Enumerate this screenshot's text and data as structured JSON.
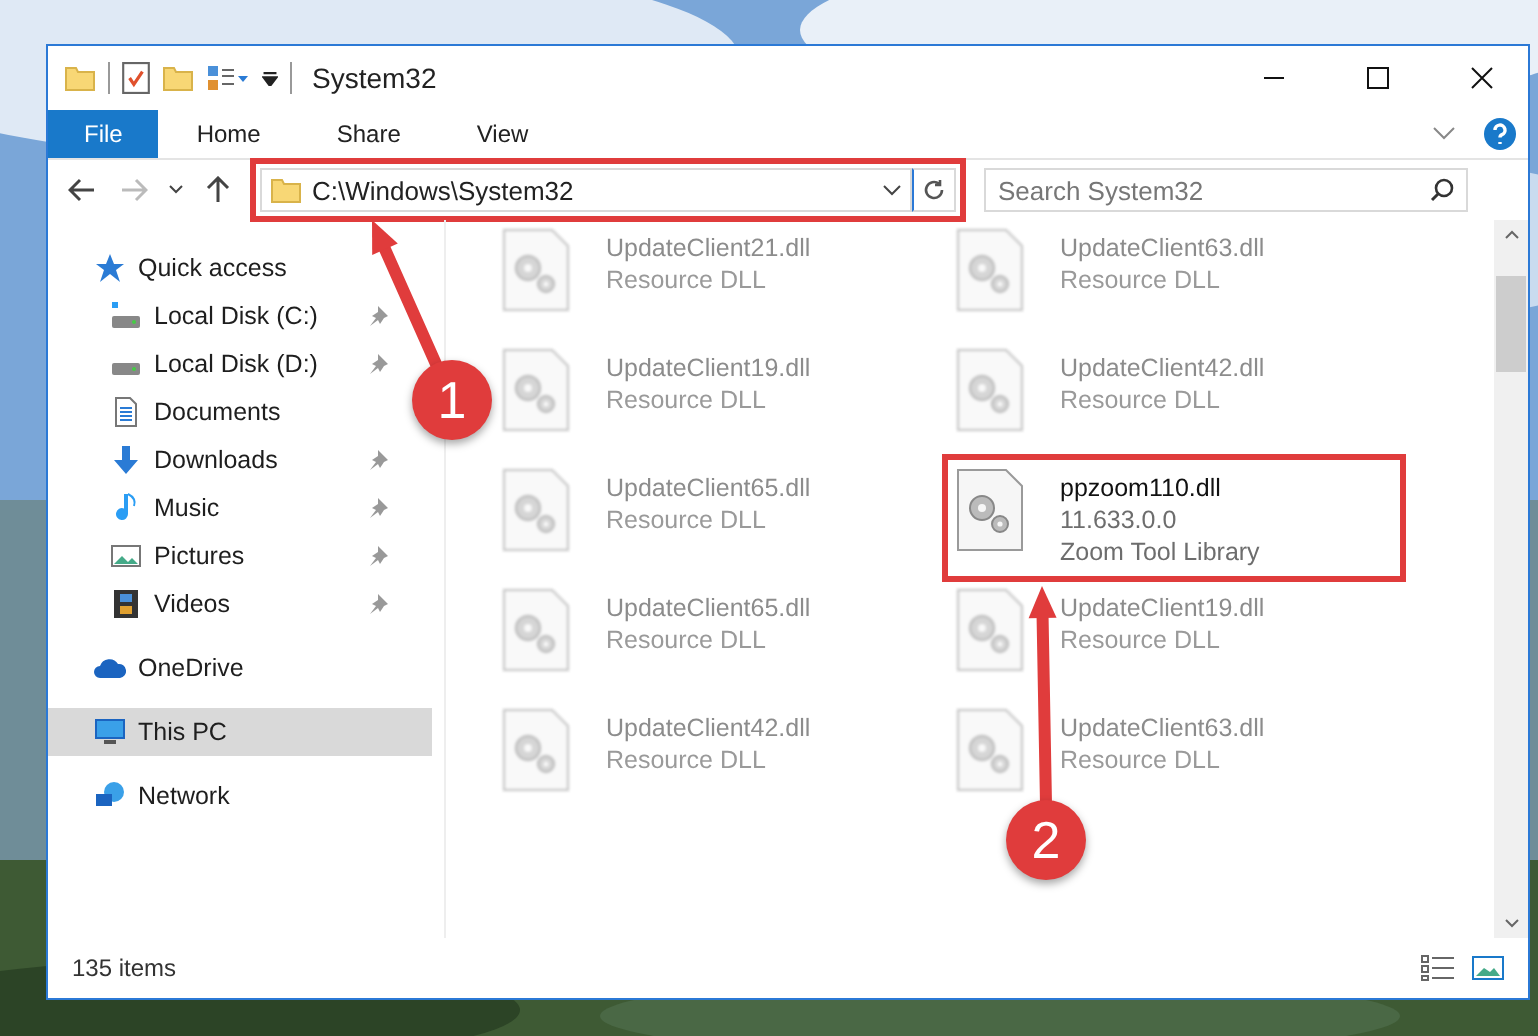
{
  "window": {
    "title": "System32"
  },
  "ribbon_tabs": [
    {
      "label": "File",
      "kind": "file"
    },
    {
      "label": "Home",
      "kind": "tab"
    },
    {
      "label": "Share",
      "kind": "tab"
    },
    {
      "label": "View",
      "kind": "tab"
    }
  ],
  "address": {
    "path": "C:\\Windows\\System32"
  },
  "search": {
    "placeholder": "Search System32"
  },
  "sidebar": {
    "items": [
      {
        "label": "Quick access",
        "kind": "star",
        "selected": false,
        "children": [
          {
            "label": "Local Disk (C:)",
            "kind": "system-drive",
            "pinned": true
          },
          {
            "label": "Local Disk (D:)",
            "kind": "drive",
            "pinned": true
          },
          {
            "label": "Documents",
            "kind": "documents",
            "pinned": false
          },
          {
            "label": "Downloads",
            "kind": "downloads",
            "pinned": true
          },
          {
            "label": "Music",
            "kind": "music",
            "pinned": true
          },
          {
            "label": "Pictures",
            "kind": "pictures",
            "pinned": true
          },
          {
            "label": "Videos",
            "kind": "videos",
            "pinned": true
          }
        ]
      },
      {
        "label": "OneDrive",
        "kind": "cloud",
        "selected": false
      },
      {
        "label": "This PC",
        "kind": "computer",
        "selected": true
      },
      {
        "label": "Network",
        "kind": "network",
        "selected": false
      }
    ]
  },
  "files": [
    {
      "lines": [
        "UpdateClient21.dll",
        "Resource DLL"
      ],
      "blurred": true,
      "highlighted": false
    },
    {
      "lines": [
        "UpdateClient63.dll",
        "Resource DLL"
      ],
      "blurred": true,
      "highlighted": false
    },
    {
      "lines": [
        "UpdateClient19.dll",
        "Resource DLL"
      ],
      "blurred": true,
      "highlighted": false
    },
    {
      "lines": [
        "UpdateClient42.dll",
        "Resource DLL"
      ],
      "blurred": true,
      "highlighted": false
    },
    {
      "lines": [
        "UpdateClient65.dll",
        "Resource DLL"
      ],
      "blurred": true,
      "highlighted": false
    },
    {
      "lines": [
        "ppzoom110.dll",
        "11.633.0.0",
        "Zoom Tool Library"
      ],
      "blurred": false,
      "highlighted": true
    },
    {
      "lines": [
        "UpdateClient65.dll",
        "Resource DLL"
      ],
      "blurred": true,
      "highlighted": false
    },
    {
      "lines": [
        "UpdateClient19.dll",
        "Resource DLL"
      ],
      "blurred": true,
      "highlighted": false
    },
    {
      "lines": [
        "UpdateClient42.dll",
        "Resource DLL"
      ],
      "blurred": true,
      "highlighted": false
    },
    {
      "lines": [
        "UpdateClient63.dll",
        "Resource DLL"
      ],
      "blurred": true,
      "highlighted": false
    }
  ],
  "status_bar": {
    "count": "135 items"
  },
  "annotations": [
    {
      "label": "1"
    },
    {
      "label": "2"
    }
  ]
}
